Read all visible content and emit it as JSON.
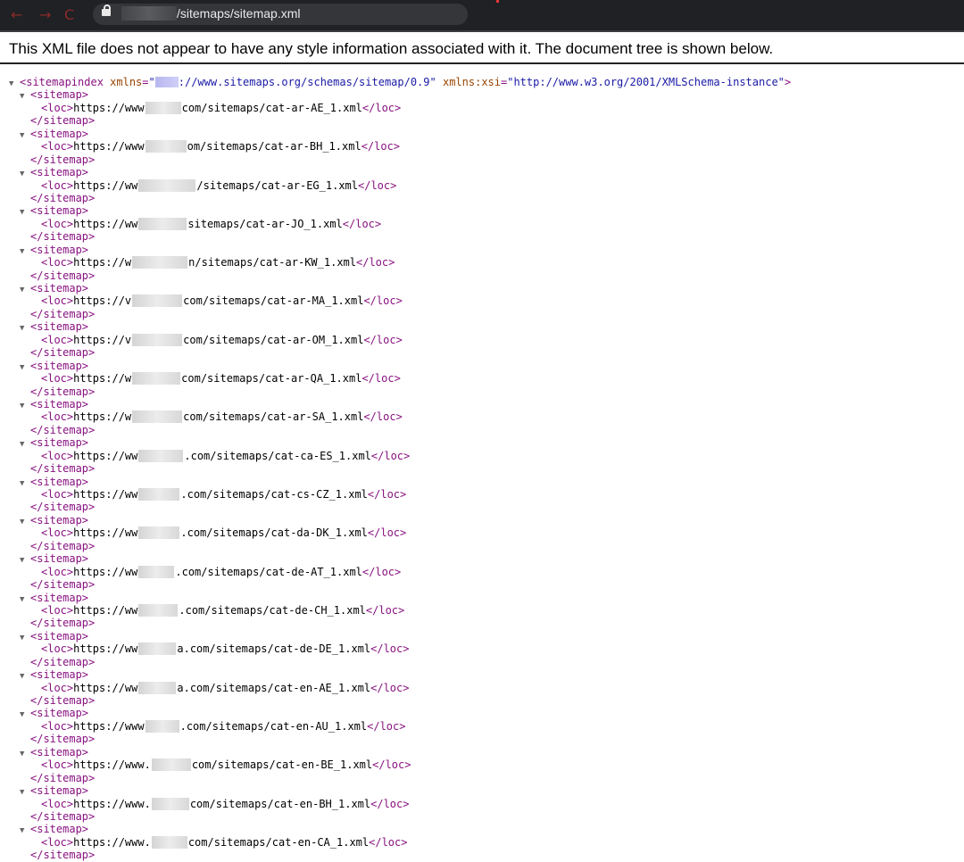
{
  "browser": {
    "back_icon": "←",
    "forward_icon": "→",
    "reload_icon": "C",
    "url_visible": "/sitemaps/sitemap.xml"
  },
  "banner": "This XML file does not appear to have any style information associated with it. The document tree is shown below.",
  "root": {
    "tag_open": "<sitemapindex",
    "attr1_name": "xmlns",
    "attr1_value_prefix": "\"",
    "attr1_value_visible": "://www.sitemaps.org/schemas/sitemap/0.9\"",
    "attr2_name": "xmlns:xsi",
    "attr2_value": "\"http://www.w3.org/2001/XMLSchema-instance\"",
    "tag_close": ">"
  },
  "sitemap_tags": {
    "open": "<sitemap>",
    "close": "</sitemap>",
    "loc_open": "<loc>",
    "loc_close": "</loc>"
  },
  "entries": [
    {
      "prefix": "https://www",
      "suffix": "com/sitemaps/cat-ar-AE_1.xml"
    },
    {
      "prefix": "https://www",
      "suffix": "om/sitemaps/cat-ar-BH_1.xml"
    },
    {
      "prefix": "https://ww",
      "suffix": "/sitemaps/cat-ar-EG_1.xml"
    },
    {
      "prefix": "https://ww",
      "suffix": "sitemaps/cat-ar-JO_1.xml"
    },
    {
      "prefix": "https://w",
      "suffix": "n/sitemaps/cat-ar-KW_1.xml"
    },
    {
      "prefix": "https://v",
      "suffix": "com/sitemaps/cat-ar-MA_1.xml"
    },
    {
      "prefix": "https://v",
      "suffix": "com/sitemaps/cat-ar-OM_1.xml"
    },
    {
      "prefix": "https://w",
      "suffix": "com/sitemaps/cat-ar-QA_1.xml"
    },
    {
      "prefix": "https://w",
      "suffix": "com/sitemaps/cat-ar-SA_1.xml"
    },
    {
      "prefix": "https://ww",
      "suffix": ".com/sitemaps/cat-ca-ES_1.xml"
    },
    {
      "prefix": "https://ww",
      "suffix": ".com/sitemaps/cat-cs-CZ_1.xml"
    },
    {
      "prefix": "https://ww",
      "suffix": ".com/sitemaps/cat-da-DK_1.xml"
    },
    {
      "prefix": "https://ww",
      "suffix": ".com/sitemaps/cat-de-AT_1.xml"
    },
    {
      "prefix": "https://ww",
      "suffix": ".com/sitemaps/cat-de-CH_1.xml"
    },
    {
      "prefix": "https://ww",
      "suffix": "a.com/sitemaps/cat-de-DE_1.xml"
    },
    {
      "prefix": "https://ww",
      "suffix": "a.com/sitemaps/cat-en-AE_1.xml"
    },
    {
      "prefix": "https://www",
      "suffix": ".com/sitemaps/cat-en-AU_1.xml"
    },
    {
      "prefix": "https://www.",
      "suffix": "com/sitemaps/cat-en-BE_1.xml"
    },
    {
      "prefix": "https://www.",
      "suffix": "com/sitemaps/cat-en-BH_1.xml"
    },
    {
      "prefix": "https://www.",
      "suffix": "com/sitemaps/cat-en-CA_1.xml"
    }
  ],
  "icons": {
    "toggle": "collapse-triangle-icon",
    "lock": "lock-icon"
  }
}
